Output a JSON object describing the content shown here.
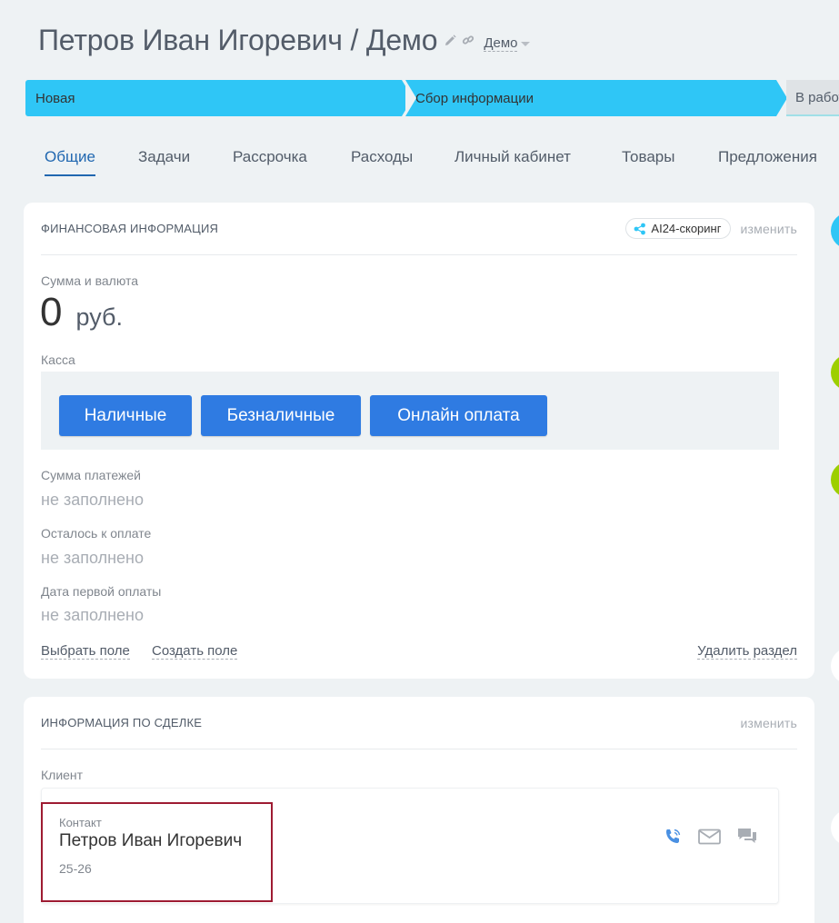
{
  "header": {
    "title": "Петров Иван Игоревич / Демо",
    "category": "Демо"
  },
  "stages": {
    "items": [
      "Новая",
      "Сбор информации",
      "В работе"
    ],
    "colors": {
      "done": "#2fc6f6",
      "upcoming": "#dfe3e6"
    }
  },
  "tabs": {
    "items": [
      "Общие",
      "Задачи",
      "Рассрочка",
      "Расходы",
      "Личный кабинет",
      "Товары",
      "Предложения"
    ],
    "active": "Общие"
  },
  "financial": {
    "title": "ФИНАНСОВАЯ ИНФОРМАЦИЯ",
    "ai_chip": "AI24-скоринг",
    "edit": "изменить",
    "amount_label": "Сумма и валюта",
    "amount_value": "0",
    "amount_currency": "руб.",
    "cashbox_label": "Касса",
    "buttons": [
      "Наличные",
      "Безналичные",
      "Онлайн оплата"
    ],
    "fields": [
      {
        "label": "Сумма платежей",
        "value": "не заполнено"
      },
      {
        "label": "Осталось к оплате",
        "value": "не заполнено"
      },
      {
        "label": "Дата первой оплаты",
        "value": "не заполнено"
      }
    ],
    "links": {
      "select_field": "Выбрать поле",
      "create_field": "Создать поле",
      "delete_section": "Удалить раздел"
    }
  },
  "deal": {
    "title": "ИНФОРМАЦИЯ ПО СДЕЛКЕ",
    "edit": "изменить",
    "client_label": "Клиент",
    "contact": {
      "type": "Контакт",
      "name": "Петров Иван Игоревич",
      "phone": "25-26"
    },
    "actions": [
      "phone-icon",
      "mail-icon",
      "chat-icon"
    ]
  },
  "colors": {
    "accent": "#2067b0",
    "button": "#2f7be2",
    "highlight": "#9e1b32",
    "side_dots": [
      "#2fc6f6",
      "#9dcf00",
      "#9dcf00",
      "#ffffff",
      "#ffffff"
    ]
  }
}
